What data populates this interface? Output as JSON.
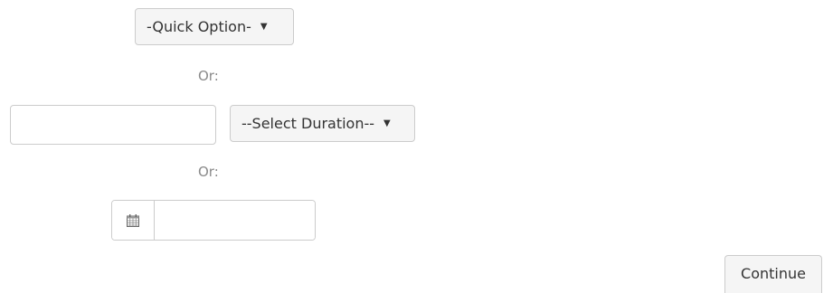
{
  "quick_option": {
    "selected": "-Quick Option-"
  },
  "separators": {
    "first": "Or:",
    "second": "Or:"
  },
  "duration": {
    "value": "",
    "placeholder": "",
    "unit_selected": "--Select Duration--"
  },
  "date": {
    "icon": "calendar-icon",
    "value": "",
    "placeholder": ""
  },
  "actions": {
    "continue_label": "Continue"
  },
  "icons": {
    "dropdown": "caret-down-icon"
  }
}
